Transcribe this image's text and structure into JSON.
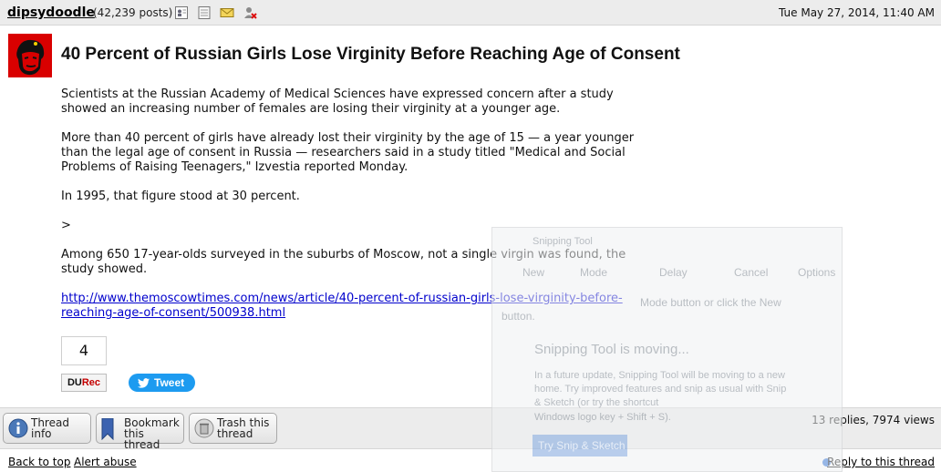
{
  "post": {
    "author": "dipsydoodle",
    "post_count": "(42,239 posts)",
    "header_icons": [
      "profile-icon",
      "journal-icon",
      "mail-icon",
      "ignore-user-icon"
    ],
    "date": "Tue May 27, 2014, 11:40 AM",
    "title": "40 Percent of Russian Girls Lose Virginity Before Reaching Age of Consent",
    "paragraphs": [
      "Scientists at the Russian Academy of Medical Sciences have expressed concern after a study showed an increasing number of females are losing their virginity at a younger age.",
      "More than 40 percent of girls have already lost their virginity by the age of 15 — a year younger than the legal age of consent in Russia — researchers said in a study titled \"Medical and Social Problems of Raising Teenagers,\" Izvestia reported Monday.",
      "In 1995, that figure stood at 30 percent.",
      ">",
      "Among 650 17-year-olds surveyed in the suburbs of Moscow, not a single virgin was found, the study showed."
    ],
    "link": "http://www.themoscowtimes.com/news/article/40-percent-of-russian-girls-lose-virginity-before-reaching-age-of-consent/500938.html",
    "recommend_count": "4",
    "durec_du": "DU",
    "durec_rec": "Rec",
    "tweet_label": "Tweet"
  },
  "toolbar": {
    "thread_info": [
      "Thread",
      "info"
    ],
    "bookmark": [
      "Bookmark",
      "this thread"
    ],
    "trash": [
      "Trash this",
      "thread"
    ],
    "stats": "13 replies, 7974 views"
  },
  "footer": {
    "back_to_top": "Back to top",
    "alert_abuse": "Alert abuse",
    "reply": "Reply to this thread"
  },
  "snipping_overlay": {
    "title": "Snipping Tool",
    "new": "New",
    "mode": "Mode",
    "delay": "Delay",
    "cancel": "Cancel",
    "options": "Options",
    "hint_line1": "Mode button or click the New",
    "hint_line2": "button.",
    "moving_title": "Snipping Tool is moving...",
    "moving_body_1": "In a future update, Snipping Tool will be moving to a new",
    "moving_body_2": "home. Try improved features and snip as usual with Snip",
    "moving_body_3": "& Sketch (or try the shortcut",
    "moving_body_4": "Windows logo key + Shift + S).",
    "try_button": "Try Snip & Sketch"
  }
}
